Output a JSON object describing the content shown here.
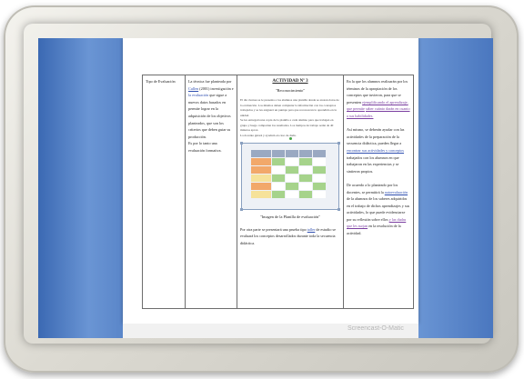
{
  "document": {
    "col1": "Tipo de Evaluación",
    "col2": {
      "p1_a": "La técnica fue planteada por",
      "p1_link": "Cullen",
      "p1_b": "(2001) investigación e",
      "p1_link2": "la evaluación",
      "p1_c": "que sigue",
      "p2": "a nuevos datos basados en",
      "p3": "permite lograr en la adquisición",
      "p4": "de los objetivos planteados, que",
      "p5": "son los criterios que deben",
      "p6": "guiar su producción.",
      "p7": "Es por lo tanto una evaluación",
      "p8": "formativa."
    },
    "col3": {
      "title": "ACTIVIDAD Nº 3",
      "subtitle": "\"Reconocimiento\"",
      "body1": "El día viernes se le presenta a los alumnos una planilla donde se anotan datos de la",
      "body2": "evaluación. Los mismos deben completar la información con los conceptos trabajados y se les",
      "body3": "asignará un puntaje para que reconozcan lo aprendido en la unidad.",
      "body4": "Se les entregará una copia de la planilla a cada alumno para que trabajen en grupo y",
      "body5": "luego compartan los resultados. Los tiempos de trabajo serán de 40 minutos aprox.",
      "body6": "La docente guiará y ayudará en caso de duda.",
      "caption": "\"Imagen de la Planilla de evaluación\"",
      "after1": "Por otra parte se presentará una prueba tipo",
      "after_link": "taller",
      "after2": "de estudio se",
      "after3": "evaluará los conceptos desarrollados durante toda la secuencia",
      "after4": "didáctica."
    },
    "col4": {
      "p1": "En la que los alumnos realizarán por los términos de la apropiación de los conceptos que tuvieron, para que se presenten",
      "p1_link": "ejemplificando el aprendizaje, que permite",
      "p1_link2": "saber cuánto darán en cuanto a sus habilidades.",
      "p2": "Así mismo, se deberán ayudar con las actividades de la preparación de la secuencia didáctica, pueden llegar a",
      "p2_link": "encontrar sus actividades y conceptos",
      "p2_b": "trabajados con los alumnos en que trabajaron en las experiencias y se sintieron propios.",
      "p3": "De acuerdo a lo planteado por los docentes, se permitirá la",
      "p3_link": "autoevaluación",
      "p3_b": "de la alumnos de los saberes adquiridos en el trabajo de dichos aprendizajes y sus actividades, lo que puede evidenciarse por su reflexión sobre ellos",
      "p3_link2": "y las dudas que les surjan",
      "p3_c": "en la resolución de la actividad."
    }
  },
  "watermark": "Screencast-O-Matic",
  "colors": {
    "screen_blue": "#4a77bf",
    "frame_silver": "#dcdad2",
    "link_blue": "#2f4fb0",
    "link_purple": "#7a3ea0"
  }
}
